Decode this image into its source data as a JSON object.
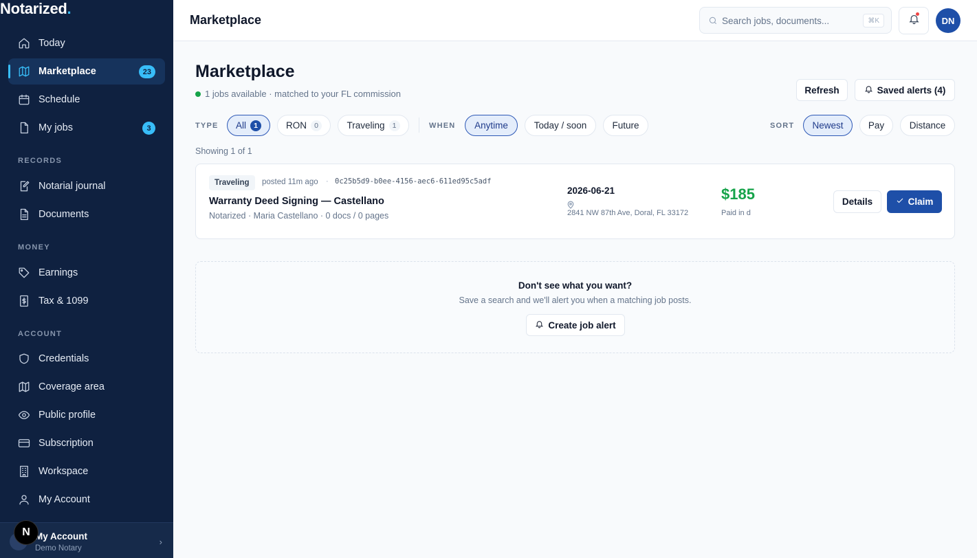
{
  "brand": {
    "name": "Notarized",
    "dot": "."
  },
  "sidebar": {
    "items": [
      {
        "label": "Today",
        "icon": "home-icon"
      },
      {
        "label": "Marketplace",
        "icon": "map-icon",
        "badge": "23"
      },
      {
        "label": "Schedule",
        "icon": "calendar-icon"
      },
      {
        "label": "My jobs",
        "icon": "file-icon",
        "badge": "3"
      }
    ],
    "sections": [
      {
        "label": "RECORDS",
        "items": [
          {
            "label": "Notarial journal",
            "icon": "journal-edit-icon"
          },
          {
            "label": "Documents",
            "icon": "document-icon"
          }
        ]
      },
      {
        "label": "MONEY",
        "items": [
          {
            "label": "Earnings",
            "icon": "tag-icon"
          },
          {
            "label": "Tax & 1099",
            "icon": "receipt-dollar-icon"
          }
        ]
      },
      {
        "label": "ACCOUNT",
        "items": [
          {
            "label": "Credentials",
            "icon": "shield-icon"
          },
          {
            "label": "Coverage area",
            "icon": "map-icon"
          },
          {
            "label": "Public profile",
            "icon": "eye-icon"
          },
          {
            "label": "Subscription",
            "icon": "credit-card-icon"
          },
          {
            "label": "Workspace",
            "icon": "building-icon"
          },
          {
            "label": "My Account",
            "icon": "user-icon"
          }
        ]
      }
    ],
    "footer": {
      "name": "My Account",
      "sub": "Demo Notary"
    },
    "n_badge": "N"
  },
  "topbar": {
    "title": "Marketplace",
    "search_placeholder": "Search jobs, documents...",
    "shortcut": "⌘K",
    "avatar_initials": "DN"
  },
  "main": {
    "title": "Marketplace",
    "subtitle": "1 jobs available · matched to your FL commission",
    "refresh_label": "Refresh",
    "saved_alerts_label": "Saved alerts (4)",
    "filters": {
      "type_label": "TYPE",
      "type_options": [
        {
          "label": "All",
          "count": "1",
          "selected": true
        },
        {
          "label": "RON",
          "count": "0",
          "selected": false
        },
        {
          "label": "Traveling",
          "count": "1",
          "selected": false
        }
      ],
      "when_label": "WHEN",
      "when_options": [
        {
          "label": "Anytime",
          "selected": true
        },
        {
          "label": "Today / soon",
          "selected": false
        },
        {
          "label": "Future",
          "selected": false
        }
      ],
      "sort_label": "SORT",
      "sort_options": [
        {
          "label": "Newest",
          "selected": true
        },
        {
          "label": "Pay",
          "selected": false
        },
        {
          "label": "Distance",
          "selected": false
        }
      ]
    },
    "showing": "Showing 1 of 1",
    "job": {
      "type": "Traveling",
      "posted": "posted 11m ago",
      "sep": "·",
      "id": "0c25b5d9-b0ee-4156-aec6-611ed95c5adf",
      "title": "Warranty Deed Signing — Castellano",
      "meta": "Notarized · Maria Castellano · 0 docs / 0 pages",
      "date": "2026-06-21",
      "address": "2841 NW 87th Ave, Doral, FL 33172",
      "pay": "$185",
      "pay_sub": "Paid in d",
      "details_label": "Details",
      "claim_label": "Claim"
    },
    "alert": {
      "title": "Don't see what you want?",
      "sub": "Save a search and we'll alert you when a matching job posts.",
      "button_label": "Create job alert"
    }
  },
  "colors": {
    "sidebar": "#0f2140",
    "accent": "#38bdf8",
    "primary": "#1e4fa8",
    "pay": "#16a34a"
  }
}
